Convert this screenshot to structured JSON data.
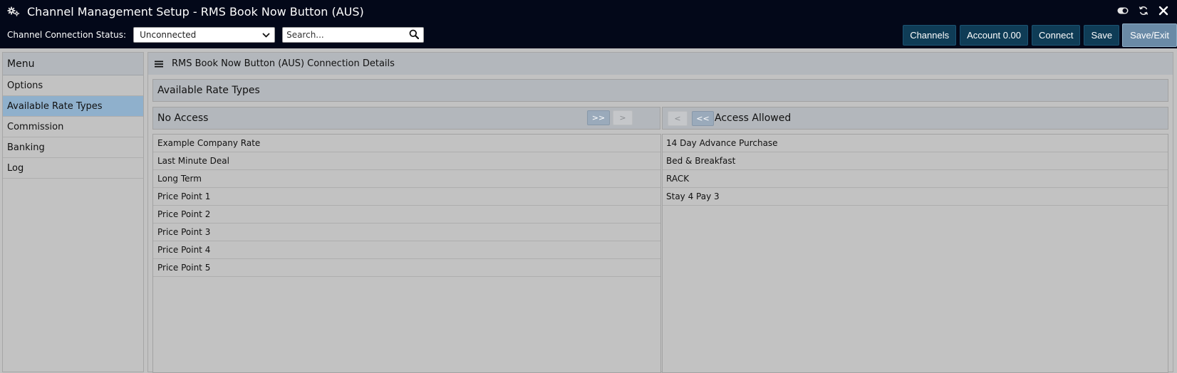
{
  "app": {
    "title": "Channel Management Setup - RMS Book Now Button (AUS)",
    "icon": "gears-icon",
    "window_controls": [
      "toggle-icon",
      "refresh-icon",
      "close-icon"
    ]
  },
  "status": {
    "label": "Channel Connection Status:",
    "selected": "Unconnected",
    "search_placeholder": "Search..."
  },
  "actions": {
    "channels": "Channels",
    "account": "Account 0.00",
    "connect": "Connect",
    "save": "Save",
    "save_exit": "Save/Exit"
  },
  "sidebar": {
    "heading": "Menu",
    "items": [
      {
        "label": "Options",
        "active": false
      },
      {
        "label": "Available Rate Types",
        "active": true
      },
      {
        "label": "Commission",
        "active": false
      },
      {
        "label": "Banking",
        "active": false
      },
      {
        "label": "Log",
        "active": false
      }
    ]
  },
  "main": {
    "panel_title": "RMS Book Now Button (AUS) Connection Details",
    "section_title": "Available Rate Types",
    "no_access": {
      "heading": "No Access",
      "move_all": ">>",
      "move_one": ">",
      "items": [
        "Example Company Rate",
        "Last Minute Deal",
        "Long Term",
        "Price Point 1",
        "Price Point 2",
        "Price Point 3",
        "Price Point 4",
        "Price Point 5"
      ]
    },
    "access_allowed": {
      "heading": "Access Allowed",
      "move_one": "<",
      "move_all": "<<",
      "items": [
        "14 Day Advance Purchase",
        "Bed & Breakfast",
        "RACK",
        "Stay 4 Pay 3"
      ]
    }
  },
  "colors": {
    "header_bg": "#030819",
    "button_bg": "#0f3c56",
    "primary_button_bg": "#6a8aa6",
    "active_menu_bg": "#8fb0cc",
    "panel_bg": "#c2c2c2"
  }
}
